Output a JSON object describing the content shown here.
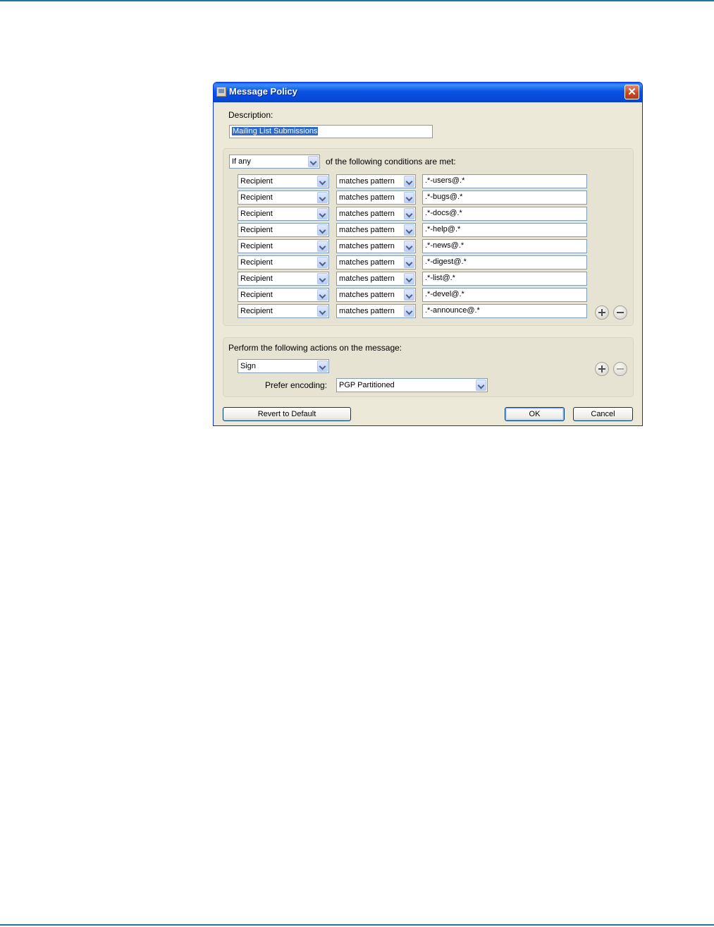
{
  "dialog": {
    "title": "Message Policy",
    "close_glyph": "✕",
    "description_label": "Description:",
    "description_value": "Mailing List Submissions"
  },
  "conditions": {
    "match_mode": "If any",
    "match_suffix": "of the following conditions are met:",
    "rows": [
      {
        "field": "Recipient",
        "operator": "matches pattern",
        "value": ".*-users@.*"
      },
      {
        "field": "Recipient",
        "operator": "matches pattern",
        "value": ".*-bugs@.*"
      },
      {
        "field": "Recipient",
        "operator": "matches pattern",
        "value": ".*-docs@.*"
      },
      {
        "field": "Recipient",
        "operator": "matches pattern",
        "value": ".*-help@.*"
      },
      {
        "field": "Recipient",
        "operator": "matches pattern",
        "value": ".*-news@.*"
      },
      {
        "field": "Recipient",
        "operator": "matches pattern",
        "value": ".*-digest@.*"
      },
      {
        "field": "Recipient",
        "operator": "matches pattern",
        "value": ".*-list@.*"
      },
      {
        "field": "Recipient",
        "operator": "matches pattern",
        "value": ".*-devel@.*"
      },
      {
        "field": "Recipient",
        "operator": "matches pattern",
        "value": ".*-announce@.*"
      }
    ]
  },
  "actions": {
    "heading": "Perform the following actions on the message:",
    "action": "Sign",
    "encoding_label": "Prefer encoding:",
    "encoding_value": "PGP Partitioned"
  },
  "buttons": {
    "revert": "Revert to Default",
    "ok": "OK",
    "cancel": "Cancel"
  },
  "icons": {
    "add": "plus-icon",
    "remove": "minus-icon",
    "dropdown": "chevron-down-icon"
  },
  "colors": {
    "titlebar": "#0a53e4",
    "dialog_bg": "#ece9d8",
    "selection": "#316ac5",
    "page_rule": "#1f78a4"
  }
}
